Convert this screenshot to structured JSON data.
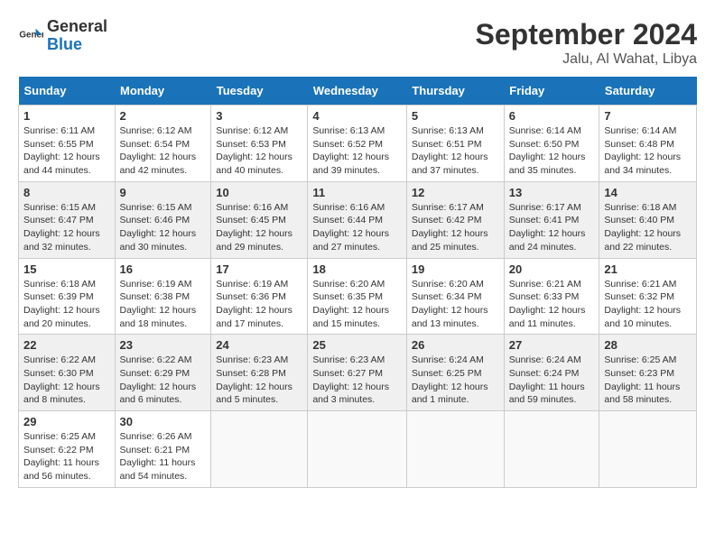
{
  "logo": {
    "text_general": "General",
    "text_blue": "Blue"
  },
  "header": {
    "month": "September 2024",
    "location": "Jalu, Al Wahat, Libya"
  },
  "weekdays": [
    "Sunday",
    "Monday",
    "Tuesday",
    "Wednesday",
    "Thursday",
    "Friday",
    "Saturday"
  ],
  "weeks": [
    [
      {
        "day": "1",
        "info": "Sunrise: 6:11 AM\nSunset: 6:55 PM\nDaylight: 12 hours\nand 44 minutes."
      },
      {
        "day": "2",
        "info": "Sunrise: 6:12 AM\nSunset: 6:54 PM\nDaylight: 12 hours\nand 42 minutes."
      },
      {
        "day": "3",
        "info": "Sunrise: 6:12 AM\nSunset: 6:53 PM\nDaylight: 12 hours\nand 40 minutes."
      },
      {
        "day": "4",
        "info": "Sunrise: 6:13 AM\nSunset: 6:52 PM\nDaylight: 12 hours\nand 39 minutes."
      },
      {
        "day": "5",
        "info": "Sunrise: 6:13 AM\nSunset: 6:51 PM\nDaylight: 12 hours\nand 37 minutes."
      },
      {
        "day": "6",
        "info": "Sunrise: 6:14 AM\nSunset: 6:50 PM\nDaylight: 12 hours\nand 35 minutes."
      },
      {
        "day": "7",
        "info": "Sunrise: 6:14 AM\nSunset: 6:48 PM\nDaylight: 12 hours\nand 34 minutes."
      }
    ],
    [
      {
        "day": "8",
        "info": "Sunrise: 6:15 AM\nSunset: 6:47 PM\nDaylight: 12 hours\nand 32 minutes."
      },
      {
        "day": "9",
        "info": "Sunrise: 6:15 AM\nSunset: 6:46 PM\nDaylight: 12 hours\nand 30 minutes."
      },
      {
        "day": "10",
        "info": "Sunrise: 6:16 AM\nSunset: 6:45 PM\nDaylight: 12 hours\nand 29 minutes."
      },
      {
        "day": "11",
        "info": "Sunrise: 6:16 AM\nSunset: 6:44 PM\nDaylight: 12 hours\nand 27 minutes."
      },
      {
        "day": "12",
        "info": "Sunrise: 6:17 AM\nSunset: 6:42 PM\nDaylight: 12 hours\nand 25 minutes."
      },
      {
        "day": "13",
        "info": "Sunrise: 6:17 AM\nSunset: 6:41 PM\nDaylight: 12 hours\nand 24 minutes."
      },
      {
        "day": "14",
        "info": "Sunrise: 6:18 AM\nSunset: 6:40 PM\nDaylight: 12 hours\nand 22 minutes."
      }
    ],
    [
      {
        "day": "15",
        "info": "Sunrise: 6:18 AM\nSunset: 6:39 PM\nDaylight: 12 hours\nand 20 minutes."
      },
      {
        "day": "16",
        "info": "Sunrise: 6:19 AM\nSunset: 6:38 PM\nDaylight: 12 hours\nand 18 minutes."
      },
      {
        "day": "17",
        "info": "Sunrise: 6:19 AM\nSunset: 6:36 PM\nDaylight: 12 hours\nand 17 minutes."
      },
      {
        "day": "18",
        "info": "Sunrise: 6:20 AM\nSunset: 6:35 PM\nDaylight: 12 hours\nand 15 minutes."
      },
      {
        "day": "19",
        "info": "Sunrise: 6:20 AM\nSunset: 6:34 PM\nDaylight: 12 hours\nand 13 minutes."
      },
      {
        "day": "20",
        "info": "Sunrise: 6:21 AM\nSunset: 6:33 PM\nDaylight: 12 hours\nand 11 minutes."
      },
      {
        "day": "21",
        "info": "Sunrise: 6:21 AM\nSunset: 6:32 PM\nDaylight: 12 hours\nand 10 minutes."
      }
    ],
    [
      {
        "day": "22",
        "info": "Sunrise: 6:22 AM\nSunset: 6:30 PM\nDaylight: 12 hours\nand 8 minutes."
      },
      {
        "day": "23",
        "info": "Sunrise: 6:22 AM\nSunset: 6:29 PM\nDaylight: 12 hours\nand 6 minutes."
      },
      {
        "day": "24",
        "info": "Sunrise: 6:23 AM\nSunset: 6:28 PM\nDaylight: 12 hours\nand 5 minutes."
      },
      {
        "day": "25",
        "info": "Sunrise: 6:23 AM\nSunset: 6:27 PM\nDaylight: 12 hours\nand 3 minutes."
      },
      {
        "day": "26",
        "info": "Sunrise: 6:24 AM\nSunset: 6:25 PM\nDaylight: 12 hours\nand 1 minute."
      },
      {
        "day": "27",
        "info": "Sunrise: 6:24 AM\nSunset: 6:24 PM\nDaylight: 11 hours\nand 59 minutes."
      },
      {
        "day": "28",
        "info": "Sunrise: 6:25 AM\nSunset: 6:23 PM\nDaylight: 11 hours\nand 58 minutes."
      }
    ],
    [
      {
        "day": "29",
        "info": "Sunrise: 6:25 AM\nSunset: 6:22 PM\nDaylight: 11 hours\nand 56 minutes."
      },
      {
        "day": "30",
        "info": "Sunrise: 6:26 AM\nSunset: 6:21 PM\nDaylight: 11 hours\nand 54 minutes."
      },
      {
        "day": "",
        "info": ""
      },
      {
        "day": "",
        "info": ""
      },
      {
        "day": "",
        "info": ""
      },
      {
        "day": "",
        "info": ""
      },
      {
        "day": "",
        "info": ""
      }
    ]
  ]
}
